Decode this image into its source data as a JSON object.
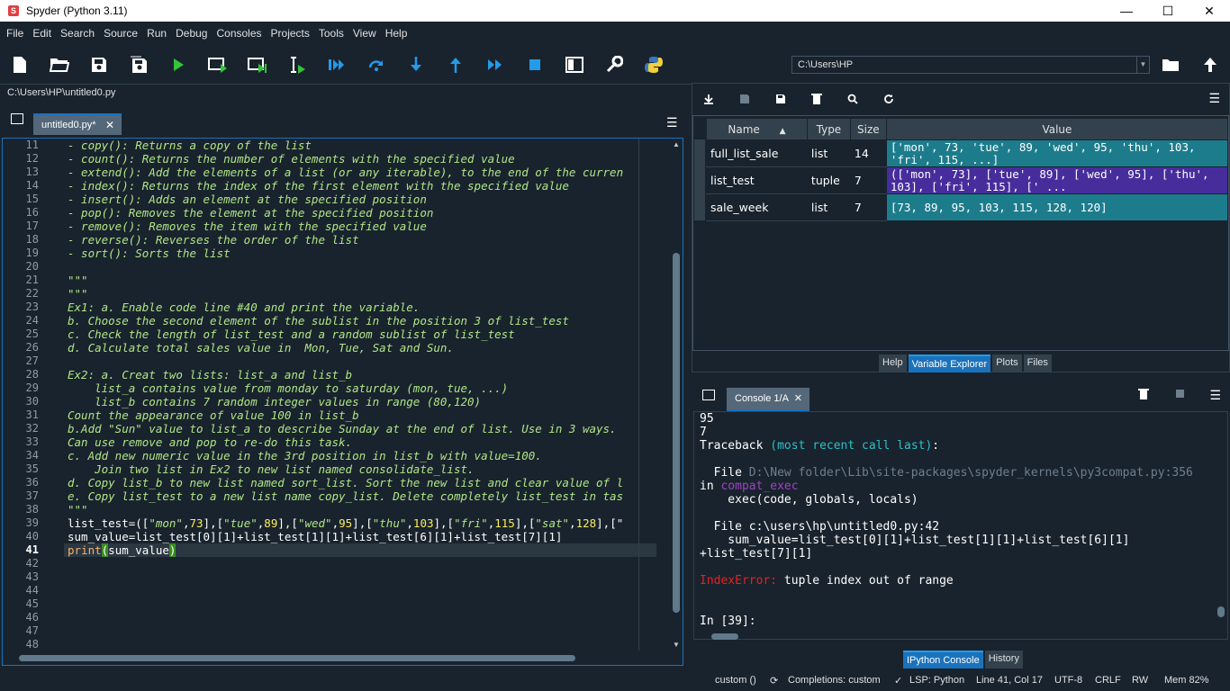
{
  "window": {
    "title": "Spyder (Python 3.11)"
  },
  "menu": [
    "File",
    "Edit",
    "Search",
    "Source",
    "Run",
    "Debug",
    "Consoles",
    "Projects",
    "Tools",
    "View",
    "Help"
  ],
  "toolbar": {
    "path": "C:\\Users\\HP"
  },
  "editor": {
    "file_path": "C:\\Users\\HP\\untitled0.py",
    "tab_label": "untitled0.py*",
    "line_numbers": [
      "11",
      "12",
      "13",
      "14",
      "15",
      "16",
      "17",
      "18",
      "19",
      "20",
      "21",
      "22",
      "23",
      "24",
      "25",
      "26",
      "27",
      "28",
      "29",
      "30",
      "31",
      "32",
      "33",
      "34",
      "35",
      "36",
      "37",
      "38",
      "39",
      "40",
      "41",
      "42",
      "43",
      "44",
      "45",
      "46",
      "47",
      "48"
    ],
    "doc_lines": [
      "- copy(): Returns a copy of the list",
      "- count(): Returns the number of elements with the specified value",
      "- extend(): Add the elements of a list (or any iterable), to the end of the curren",
      "- index(): Returns the index of the first element with the specified value",
      "- insert(): Adds an element at the specified position",
      "- pop(): Removes the element at the specified position",
      "- remove(): Removes the item with the specified value",
      "- reverse(): Reverses the order of the list",
      "- sort(): Sorts the list",
      "",
      "\"\"\"",
      "\"\"\"",
      "Ex1: a. Enable code line #40 and print the variable.",
      "b. Choose the second element of the sublist in the position 3 of list_test",
      "c. Check the length of list_test and a random sublist of list_test",
      "d. Calculate total sales value in  Mon, Tue, Sat and Sun.",
      "",
      "Ex2: a. Creat two lists: list_a and list_b",
      "    list_a contains value from monday to saturday (mon, tue, ...)",
      "    list_b contains 7 random integer values in range (80,120)",
      "Count the appearance of value 100 in list_b",
      "b.Add \"Sun\" value to list_a to describe Sunday at the end of list. Use in 3 ways.",
      "Can use remove and pop to re-do this task.",
      "c. Add new numeric value in the 3rd position in list_b with value=100.",
      "    Join two list in Ex2 to new list named consolidate_list.",
      "d. Copy list_b to new list named sort_list. Sort the new list and clear value of l",
      "e. Copy list_test to a new list name copy_list. Delete completely list_test in tas",
      "\"\"\""
    ],
    "code39": {
      "a": "list_test=([",
      "s1": "\"mon\"",
      "c1": ",",
      "n1": "73",
      "b": "],[",
      "s2": "\"tue\"",
      "n2": "89",
      "s3": "\"wed\"",
      "n3": "95",
      "s4": "\"thu\"",
      "n4": "103",
      "s5": "\"fri\"",
      "n5": "115",
      "s6": "\"sat\"",
      "n6": "128",
      "tail": "],[\""
    },
    "code40": "sum_value=list_test[0][1]+list_test[1][1]+list_test[6][1]+list_test[7][1]",
    "code41": {
      "fn": "print",
      "open": "(",
      "arg": "sum_value",
      "close": ")"
    }
  },
  "right_toolbar_icons": [
    "import-icon",
    "save-icon",
    "save-as-icon",
    "delete-icon",
    "search-icon",
    "refresh-icon"
  ],
  "variables": {
    "headers": [
      "Name",
      "Type",
      "Size",
      "Value"
    ],
    "rows": [
      {
        "name": "full_list_sale",
        "type": "list",
        "size": "14",
        "value": "['mon', 73, 'tue', 89, 'wed', 95, 'thu', 103, 'fri', 115, ...]",
        "color": "#1c7c8c"
      },
      {
        "name": "list_test",
        "type": "tuple",
        "size": "7",
        "value": "(['mon', 73], ['tue', 89], ['wed', 95], ['thu', 103], ['fri', 115], [' ...",
        "color": "#472d9c"
      },
      {
        "name": "sale_week",
        "type": "list",
        "size": "7",
        "value": "[73, 89, 95, 103, 115, 128, 120]",
        "color": "#1c7c8c"
      }
    ]
  },
  "top_right_tabs": [
    "Help",
    "Variable Explorer",
    "Plots",
    "Files"
  ],
  "console": {
    "tab_label": "Console 1/A",
    "lines": {
      "l1": "95",
      "l2": "7",
      "tb_a": "Traceback ",
      "tb_b": "(most recent call last)",
      "tb_c": ":",
      "f1_a": "  File ",
      "f1_b": "D:\\New folder\\Lib\\site-packages\\spyder_kernels\\py3compat.py:356",
      "in_a": "in ",
      "in_b": "compat_exec",
      "exec": "    exec(code, globals, locals)",
      "f2": "  File c:\\users\\hp\\untitled0.py:42",
      "sum1": "    sum_value=list_test[0][1]+list_test[1][1]+list_test[6][1]",
      "sum2": "+list_test[7][1]",
      "err_a": "IndexError:",
      "err_b": " tuple index out of range",
      "prompt": "In [39]:"
    }
  },
  "bottom_right_tabs": [
    "IPython Console",
    "History"
  ],
  "status": {
    "custom": "custom ()",
    "completions": "Completions: custom",
    "lsp": "LSP: Python",
    "pos": "Line 41, Col 17",
    "enc": "UTF-8",
    "eol": "CRLF",
    "rw": "RW",
    "mem": "Mem 82%"
  },
  "colors": {
    "accent": "#1a72bb",
    "background": "#19232d"
  }
}
